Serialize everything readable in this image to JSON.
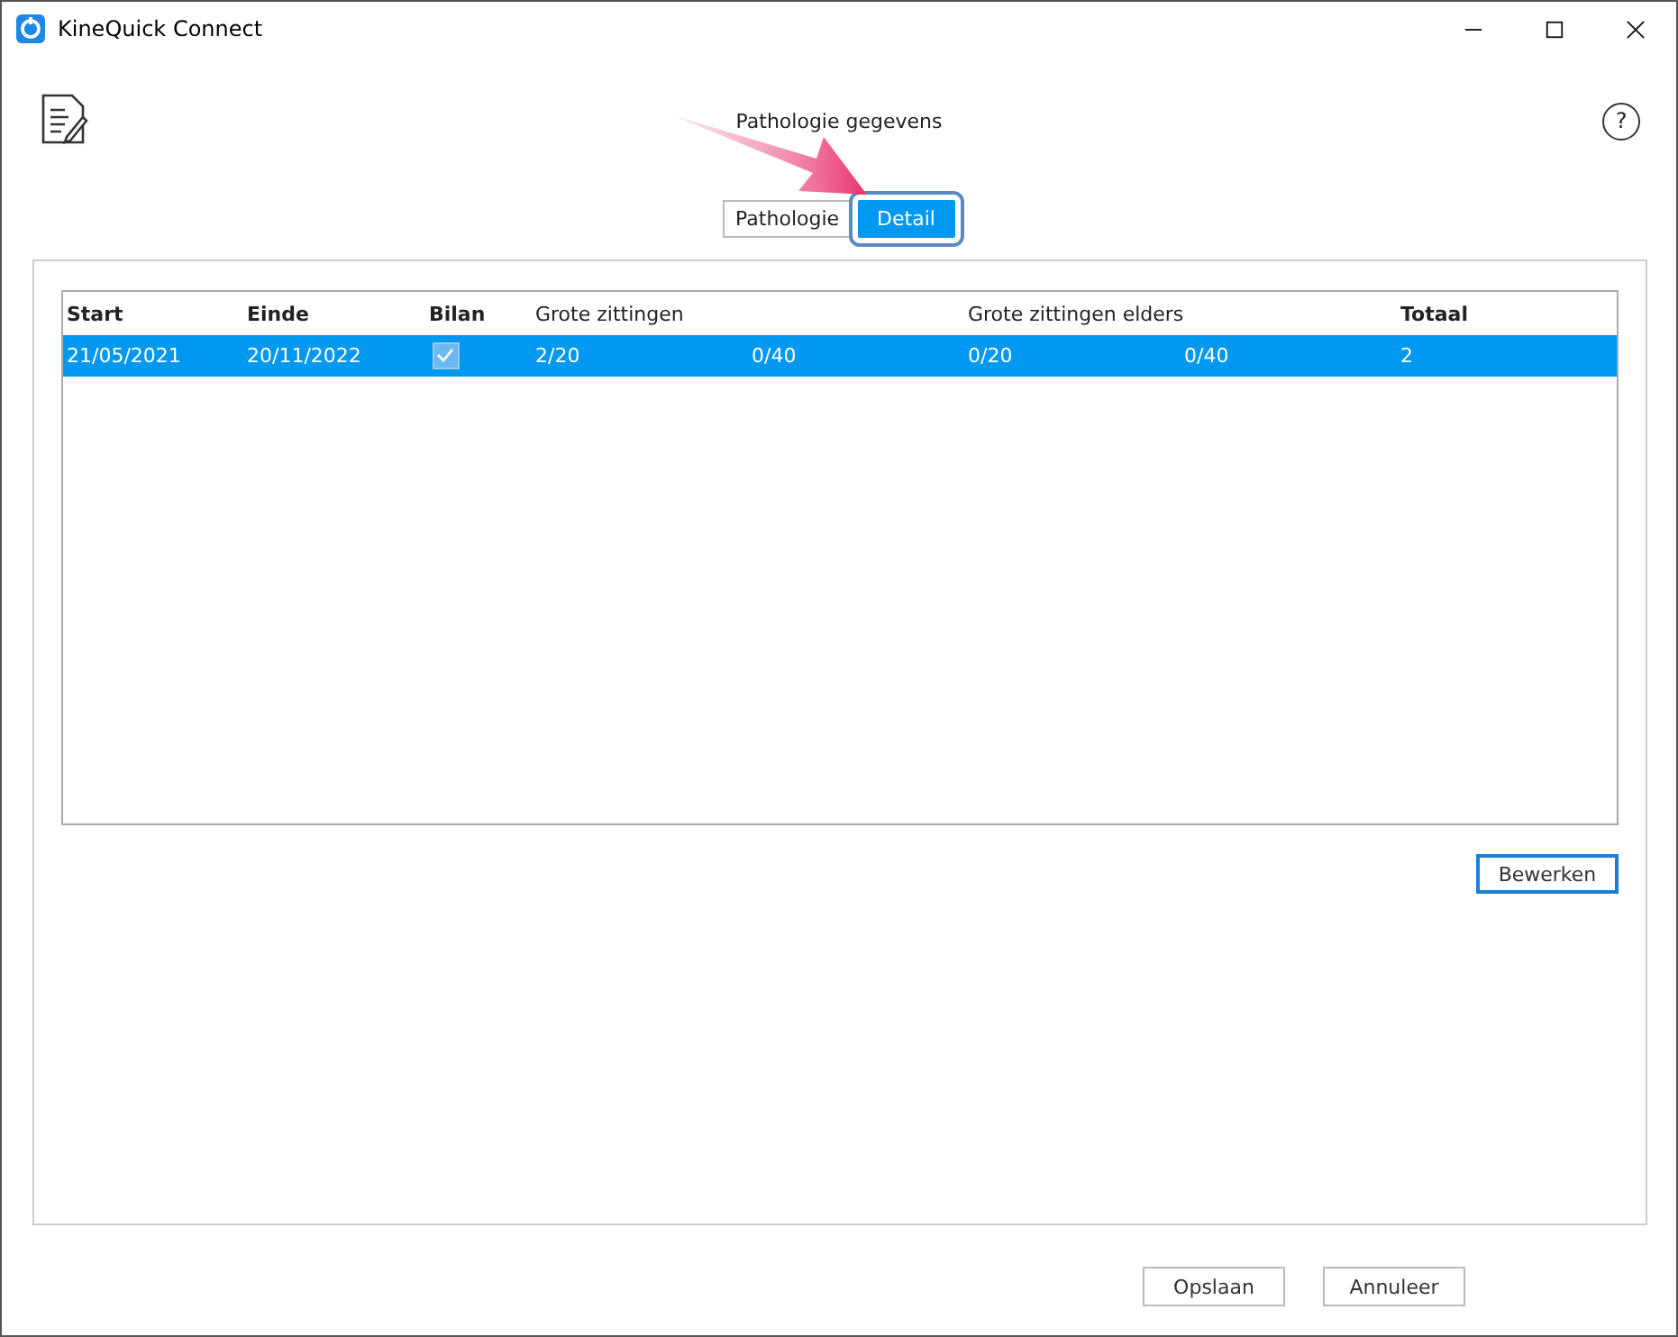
{
  "window": {
    "title": "KineQuick Connect"
  },
  "header": {
    "title": "Pathologie gegevens",
    "help": "?"
  },
  "tabs": [
    {
      "label": "Pathologie",
      "selected": false
    },
    {
      "label": "Detail",
      "selected": true
    }
  ],
  "table": {
    "columns": [
      "Start",
      "Einde",
      "Bilan",
      "Grote zittingen",
      "",
      "Grote zittingen elders",
      "",
      "Totaal"
    ],
    "rows": [
      {
        "selected": true,
        "cells": [
          {
            "kind": "text",
            "text": "21/05/2021"
          },
          {
            "kind": "text",
            "text": "20/11/2022"
          },
          {
            "kind": "check",
            "checked": true
          },
          {
            "kind": "text",
            "text": "2/20"
          },
          {
            "kind": "text",
            "text": "0/40"
          },
          {
            "kind": "text",
            "text": "0/20"
          },
          {
            "kind": "text",
            "text": "0/40"
          },
          {
            "kind": "text",
            "text": "2"
          }
        ]
      }
    ]
  },
  "edit_button": "Bewerken",
  "buttons": [
    "Opslaan",
    "Annuleer"
  ]
}
